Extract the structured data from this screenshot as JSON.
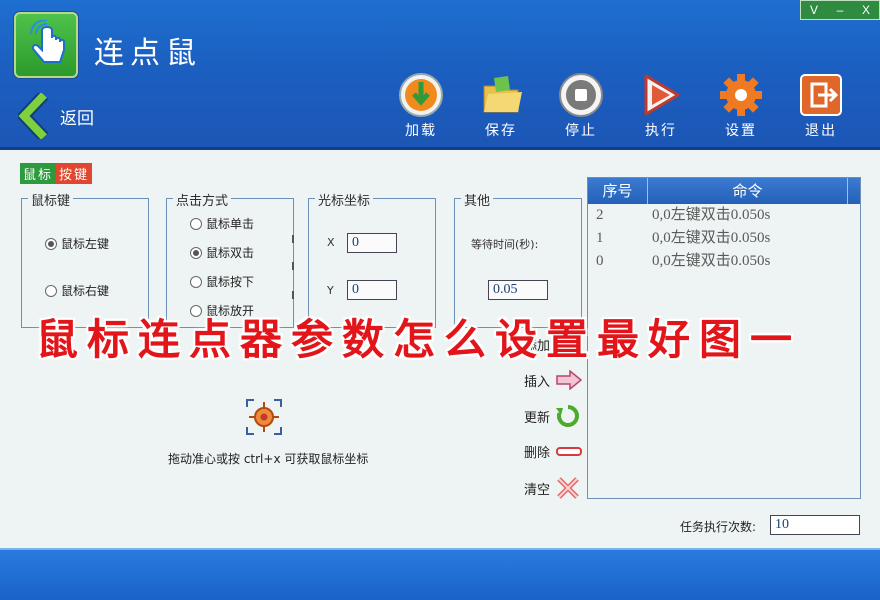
{
  "app": {
    "title": "连点鼠"
  },
  "window_controls": {
    "restore": "V",
    "minimize": "–",
    "close": "X"
  },
  "nav": {
    "back_label": "返回"
  },
  "toolbar": [
    {
      "name": "load",
      "label": "加载",
      "icon": "load-icon"
    },
    {
      "name": "save",
      "label": "保存",
      "icon": "folder-icon"
    },
    {
      "name": "stop",
      "label": "停止",
      "icon": "stop-icon"
    },
    {
      "name": "run",
      "label": "执行",
      "icon": "play-icon"
    },
    {
      "name": "settings",
      "label": "设置",
      "icon": "gear-icon"
    },
    {
      "name": "exit",
      "label": "退出",
      "icon": "exit-icon"
    }
  ],
  "tab": {
    "part1": "鼠标",
    "part2": "按键"
  },
  "mouse_key": {
    "title": "鼠标键",
    "left": "鼠标左键",
    "right": "鼠标右键",
    "selected": "left"
  },
  "click_mode": {
    "title": "点击方式",
    "single": "鼠标单击",
    "double": "鼠标双击",
    "press": "鼠标按下",
    "release": "鼠标放开",
    "selected": "double"
  },
  "cursor": {
    "title": "光标坐标",
    "x_label": "X",
    "x_value": "0",
    "y_label": "Y",
    "y_value": "0"
  },
  "other": {
    "title": "其他",
    "wait_label": "等待时间(秒):",
    "wait_value": "0.05"
  },
  "commands": {
    "header_index": "序号",
    "header_command": "命令",
    "rows": [
      {
        "index": "2",
        "command": "0,0左键双击0.050s"
      },
      {
        "index": "1",
        "command": "0,0左键双击0.050s"
      },
      {
        "index": "0",
        "command": "0,0左键双击0.050s"
      }
    ]
  },
  "side_buttons": {
    "add": "添加",
    "insert": "插入",
    "update": "更新",
    "delete": "删除",
    "clear": "清空"
  },
  "hint": "拖动准心或按 ctrl+x 可获取鼠标坐标",
  "overlay": "鼠标连点器参数怎么设置最好图一",
  "task_count": {
    "label": "任务执行次数:",
    "value": "10"
  }
}
